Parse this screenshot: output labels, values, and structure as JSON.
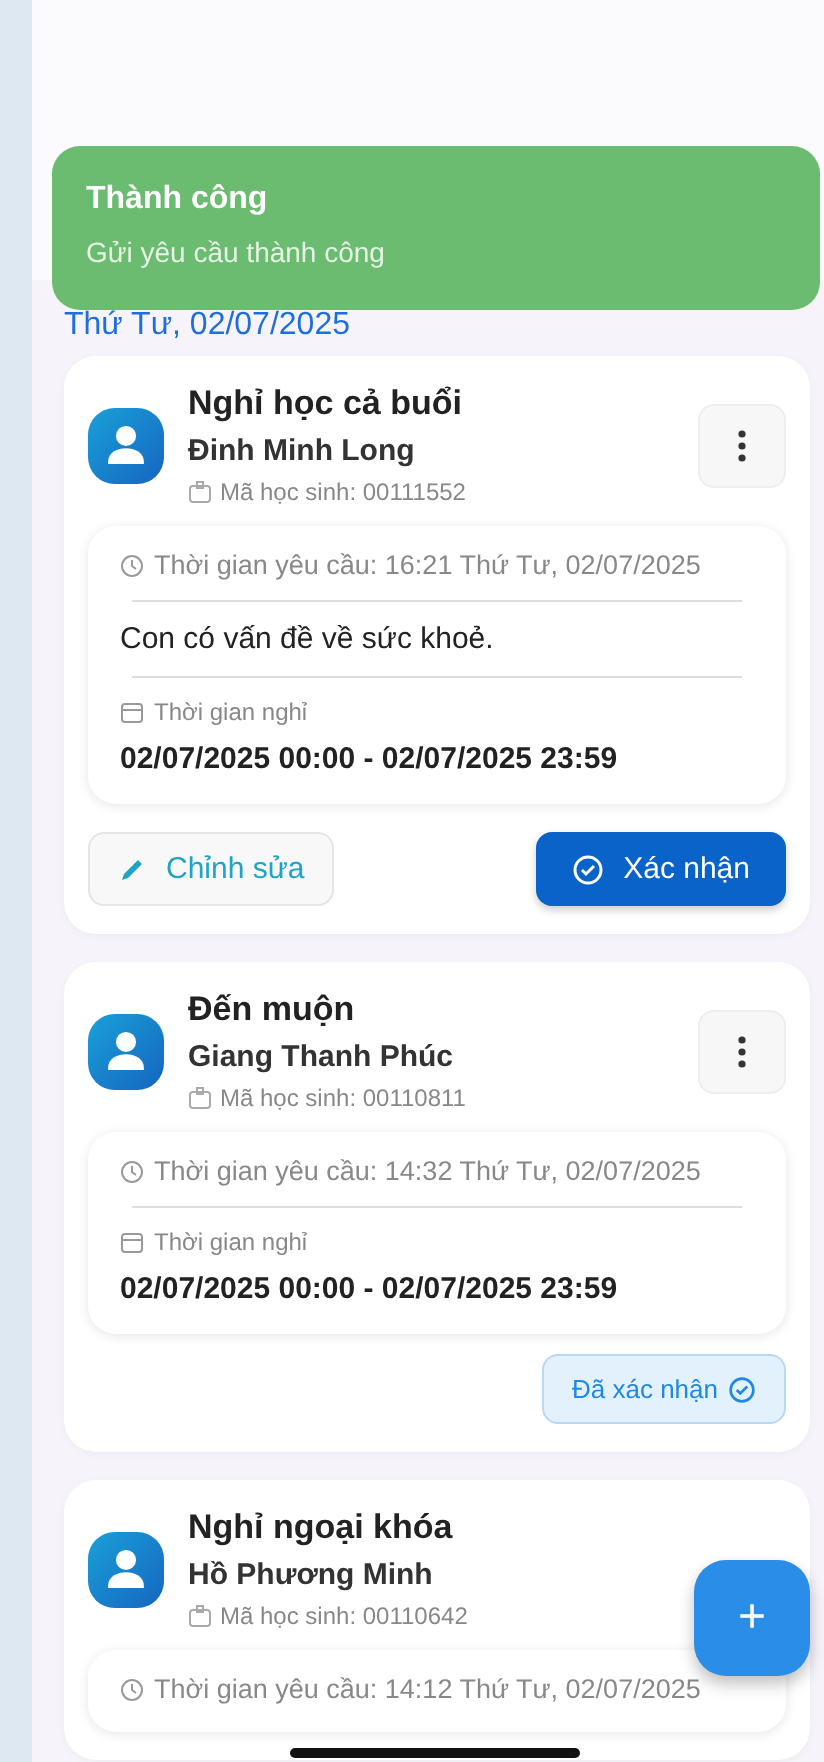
{
  "toast": {
    "title": "Thành công",
    "message": "Gửi yêu cầu thành công"
  },
  "date_header": "Thứ Tư, 02/07/2025",
  "requests": [
    {
      "type": "Nghỉ học cả buổi",
      "student": "Đinh Minh Long",
      "student_id": "Mã học sinh: 00111552",
      "request_time": "Thời gian yêu cầu: 16:21 Thứ Tư, 02/07/2025",
      "reason": "Con có vấn đề về sức khoẻ.",
      "leave_label": "Thời gian nghỉ",
      "leave_range": "02/07/2025 00:00 - 02/07/2025 23:59",
      "kind": "pending",
      "edit_label": "Chỉnh sửa",
      "confirm_label": "Xác nhận"
    },
    {
      "type": "Đến muộn",
      "student": "Giang Thanh Phúc",
      "student_id": "Mã học sinh: 00110811",
      "request_time": "Thời gian yêu cầu: 14:32 Thứ Tư, 02/07/2025",
      "leave_label": "Thời gian nghỉ",
      "leave_range": "02/07/2025 00:00 - 02/07/2025 23:59",
      "kind": "confirmed",
      "status_label": "Đã xác nhận"
    },
    {
      "type": "Nghỉ ngoại khóa",
      "student": "Hồ Phương Minh",
      "student_id": "Mã học sinh: 00110642",
      "request_time": "Thời gian yêu cầu: 14:12 Thứ Tư, 02/07/2025",
      "kind": "partial"
    }
  ],
  "fab_label": "+"
}
